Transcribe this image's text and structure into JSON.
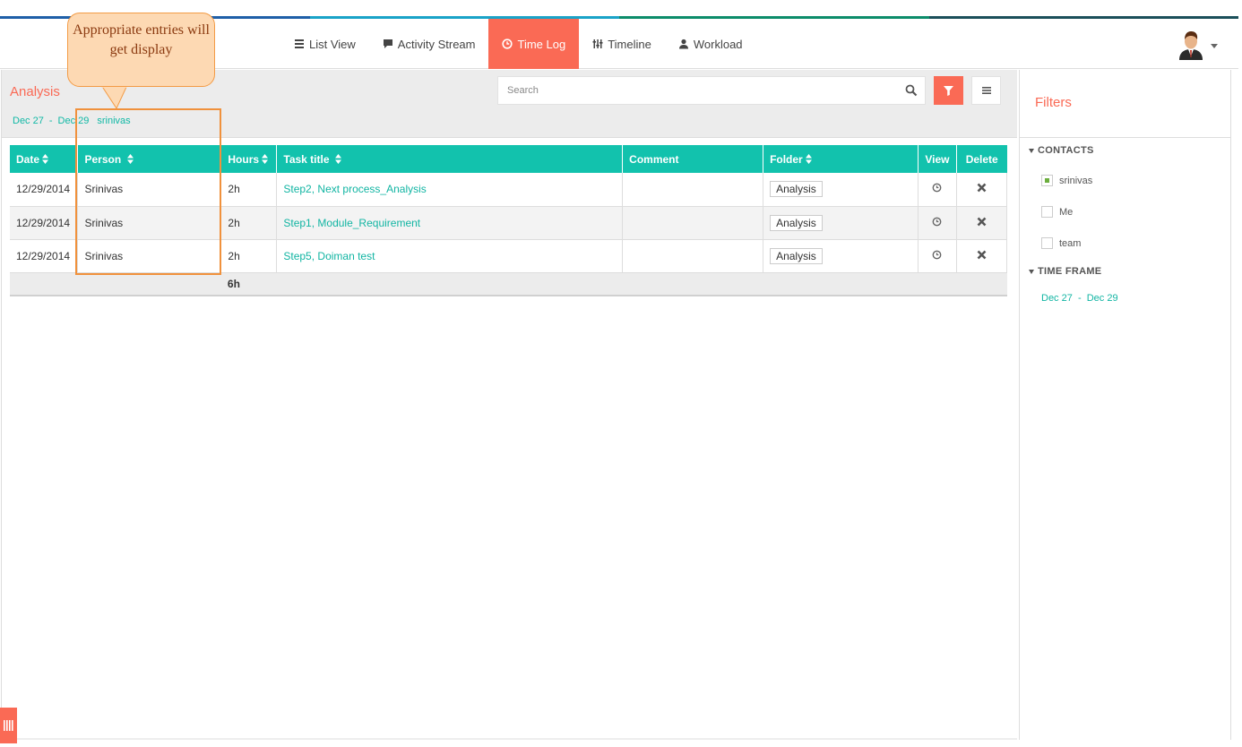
{
  "topbar_colors": [
    "#1f5fa8",
    "#1aa3c8",
    "#0c8c6a",
    "#1b4f5a"
  ],
  "accent": "#fa6a55",
  "teal": "#12c2ad",
  "nav": {
    "items": [
      {
        "label": "List View",
        "icon": "list-icon",
        "active": false
      },
      {
        "label": "Activity Stream",
        "icon": "comment-icon",
        "active": false
      },
      {
        "label": "Time Log",
        "icon": "clock-icon",
        "active": true
      },
      {
        "label": "Timeline",
        "icon": "sliders-icon",
        "active": false
      },
      {
        "label": "Workload",
        "icon": "user-icon",
        "active": false
      }
    ]
  },
  "main": {
    "title": "Analysis",
    "crumbs": {
      "range_start": "Dec 27",
      "separator": "-",
      "range_end": "Dec 29",
      "person": "srinivas"
    },
    "search_placeholder": "Search"
  },
  "callout": {
    "text": "Appropriate entries will get display"
  },
  "table": {
    "headers": {
      "date": "Date",
      "person": "Person",
      "hours": "Hours",
      "task": "Task title",
      "comment": "Comment",
      "folder": "Folder",
      "view": "View",
      "delete": "Delete"
    },
    "rows": [
      {
        "date": "12/29/2014",
        "person": "Srinivas",
        "hours": "2h",
        "task": "Step2, Next process_Analysis",
        "comment": "",
        "folder": "Analysis"
      },
      {
        "date": "12/29/2014",
        "person": "Srinivas",
        "hours": "2h",
        "task": "Step1, Module_Requirement",
        "comment": "",
        "folder": "Analysis"
      },
      {
        "date": "12/29/2014",
        "person": "Srinivas",
        "hours": "2h",
        "task": "Step5, Doiman test",
        "comment": "",
        "folder": "Analysis"
      }
    ],
    "total_hours": "6h"
  },
  "filters": {
    "title": "Filters",
    "contacts_label": "CONTACTS",
    "contacts": [
      {
        "name": "srinivas",
        "checked": true
      },
      {
        "name": "Me",
        "checked": false
      },
      {
        "name": "team",
        "checked": false
      }
    ],
    "timeframe_label": "TIME FRAME",
    "timeframe_value": "Dec 27  -  Dec 29"
  }
}
